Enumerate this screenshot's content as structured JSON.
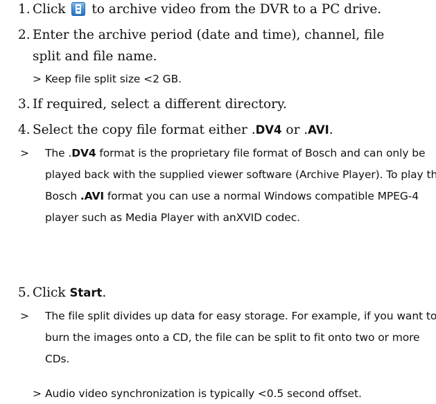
{
  "steps": [
    {
      "number": "1.",
      "before_icon": "Click",
      "icon": "archive-icon",
      "after_icon": "to archive video from the DVR to a PC drive."
    },
    {
      "number": "2.",
      "line1": "Enter the archive period (date and time), channel, file",
      "line2": "split and file name.",
      "note": "Keep file split size <2 GB."
    },
    {
      "number": "3.",
      "text": "If required, select a different directory."
    },
    {
      "number": "4.",
      "before_dv4": "Select the copy file format either .",
      "dv4": "DV4",
      "mid": " or .",
      "avi": "AVI",
      "end": ".",
      "note_a": "The .",
      "note_dv4": "DV4",
      "note_b": " format is the proprietary file format of Bosch and can only be played back with the supplied viewer software (Archive Player). To play the Bosch ",
      "note_avi": ".AVI",
      "note_c": " format you can use a normal Windows compatible MPEG-4 player such as Media Player with anXVID codec."
    },
    {
      "number": "5.",
      "before": "Click ",
      "start": "Start",
      "end": ".",
      "note1": "The file split divides up data for easy storage. For example, if you want to burn the images onto a CD, the file can be split to fit onto two or more CDs.",
      "note2": "Audio video synchronization is typically <0.5 second offset."
    }
  ],
  "note_marker": ">"
}
